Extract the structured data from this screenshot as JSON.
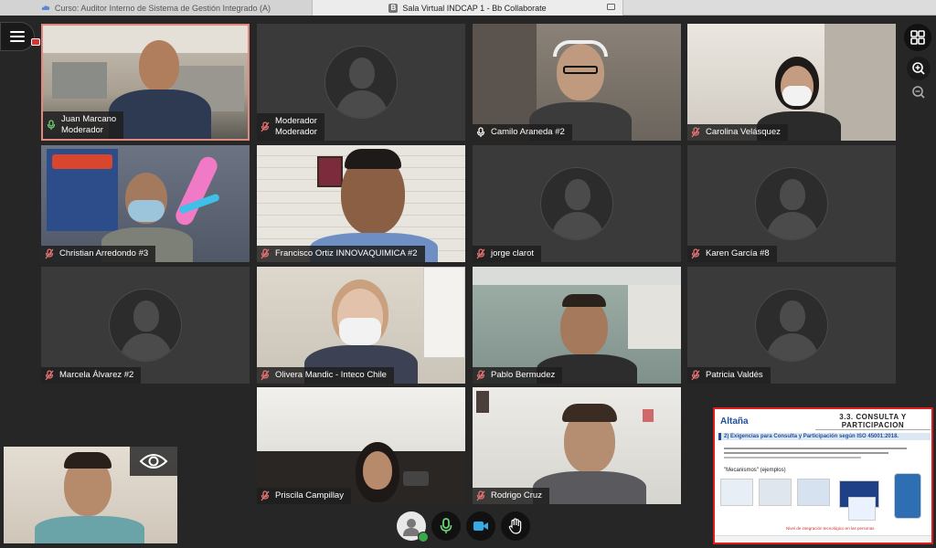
{
  "browser": {
    "tabs": [
      {
        "label": "Curso: Auditor Interno de Sistema de Gestión Integrado (A)"
      },
      {
        "label": "Sala Virtual INDCAP 1 - Bb Collaborate"
      }
    ]
  },
  "participants": [
    {
      "name": "Juan Marcano",
      "role": "Moderador",
      "mic": "on",
      "video": true
    },
    {
      "name": "Moderador",
      "role": "Moderador",
      "mic": "muted",
      "video": false
    },
    {
      "name": "Camilo Araneda #2",
      "mic": "on",
      "video": true
    },
    {
      "name": "Carolina Velásquez",
      "mic": "muted",
      "video": true
    },
    {
      "name": "Christian Arredondo #3",
      "mic": "muted",
      "video": true
    },
    {
      "name": "Francisco Ortiz INNOVAQUIMICA #2",
      "mic": "muted",
      "video": true
    },
    {
      "name": "jorge clarot",
      "mic": "muted",
      "video": false
    },
    {
      "name": "Karen García #8",
      "mic": "muted",
      "video": false
    },
    {
      "name": "Marcela Álvarez #2",
      "mic": "muted",
      "video": false
    },
    {
      "name": "Olivera Mandic - Inteco Chile",
      "mic": "muted",
      "video": true
    },
    {
      "name": "Pablo Bermudez",
      "mic": "muted",
      "video": true
    },
    {
      "name": "Patricia Valdés",
      "mic": "muted",
      "video": false
    },
    {
      "name": "Priscila Campillay",
      "mic": "muted",
      "video": true
    },
    {
      "name": "Rodrigo Cruz",
      "mic": "muted",
      "video": true
    }
  ],
  "shared_content": {
    "logo": "Altaña",
    "title_line1": "3.3. CONSULTA Y",
    "title_line2": "PARTICIPACION",
    "subtitle": "2) Exigencias para Consulta y Participación según ISO 45001:2018.",
    "section": "\"Mecanismos\" (ejemplos)",
    "footer": "Nivel de integración tecnológico en las personas"
  },
  "colors": {
    "background": "#262626",
    "tile": "#3a3a3a",
    "active_border": "#e0897f",
    "mute_red": "#e57373",
    "share_border": "#e01d1d"
  },
  "icons": {
    "menu": "hamburger-icon",
    "grid": "grid-view-icon",
    "zoom_in": "zoom-in-icon",
    "zoom_out": "zoom-out-icon",
    "mic": "microphone-icon",
    "camera": "camera-icon",
    "hand": "raise-hand-icon",
    "eye": "eye-icon"
  }
}
